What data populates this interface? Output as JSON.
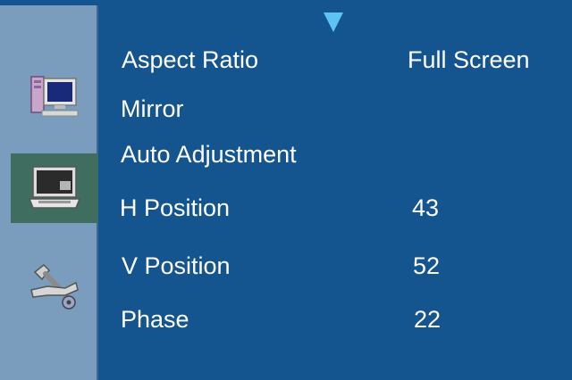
{
  "sidebar": {
    "items": [
      {
        "icon": "computer-monitor-icon",
        "active": false
      },
      {
        "icon": "laptop-display-icon",
        "active": true
      },
      {
        "icon": "tools-wrench-icon",
        "active": false
      }
    ]
  },
  "menu": {
    "scroll_indicator": "down-arrow-icon",
    "rows": [
      {
        "label": "Aspect Ratio",
        "value": "Full Screen"
      },
      {
        "label": "Mirror",
        "value": ""
      },
      {
        "label": "Auto Adjustment",
        "value": ""
      },
      {
        "label": "H Position",
        "value": "43"
      },
      {
        "label": "V Position",
        "value": "52"
      },
      {
        "label": "Phase",
        "value": "22"
      }
    ]
  },
  "colors": {
    "background": "#14548f",
    "sidebar": "#7a9dbd",
    "sidebar_active": "#3f6e60",
    "arrow": "#5cc4f4",
    "text": "#ffffff"
  }
}
